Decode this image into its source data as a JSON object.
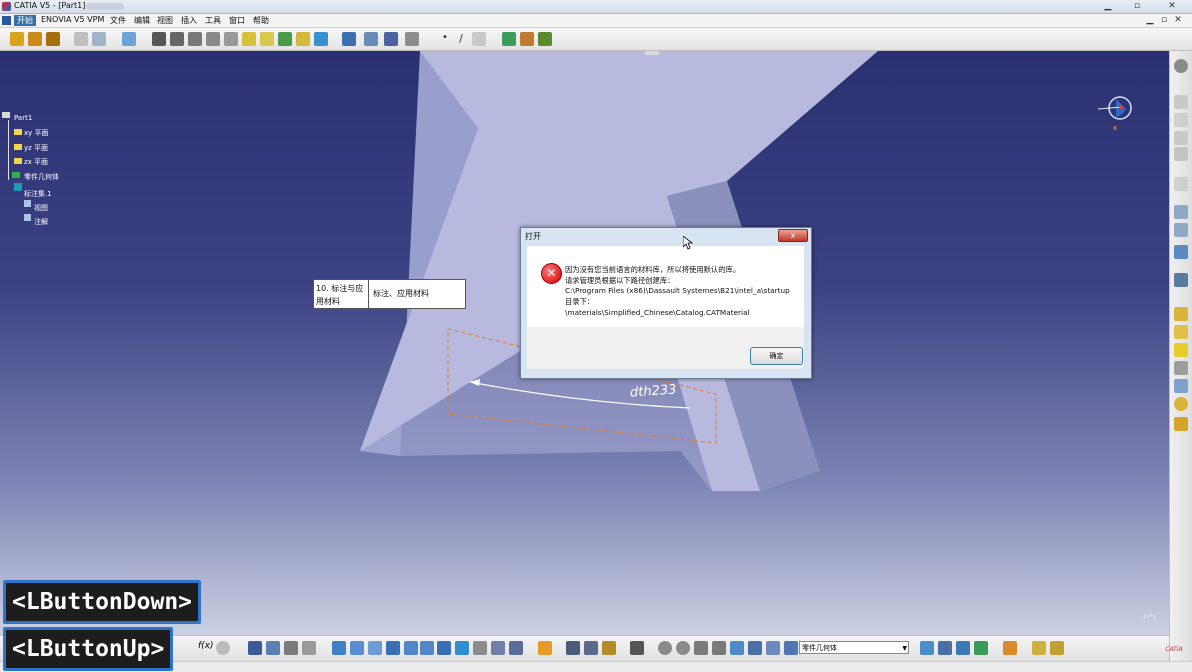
{
  "window": {
    "title": "CATIA V5 - [Part1]",
    "min_icon": "minimize-icon",
    "max_icon": "restore-icon",
    "close_icon": "close-icon"
  },
  "menu": {
    "items": [
      "开始",
      "ENOVIA V5 VPM",
      "文件",
      "编辑",
      "视图",
      "插入",
      "工具",
      "窗口",
      "帮助"
    ]
  },
  "tree": {
    "root": "Part1",
    "items": [
      "xy 平面",
      "yz 平面",
      "zx 平面",
      "零件几何体",
      "标注集.1",
      "视图",
      "注解"
    ]
  },
  "tooltip": {
    "col1": "10. 标注与应用材料",
    "col2": "标注、应用材料"
  },
  "dimension_label": "dth233",
  "dialog": {
    "title": "打开",
    "close_label": "x",
    "lines": [
      "因为没有您当前语言的材料库，所以将使用默认的库。",
      "请求管理员根据以下路径创建库：",
      "C:\\Program Files (x86)\\Dassault Systemes\\B21\\intel_a\\startup",
      "目录下：",
      "\\materials\\Simplified_Chinese\\Catalog.CATMaterial"
    ],
    "ok_label": "确定"
  },
  "bottom": {
    "combo_value": "零件几何体"
  },
  "overlays": {
    "down": "<LButtonDown>",
    "up": "<LButtonUp>"
  },
  "colors": {
    "viewport_top": "#2b3071",
    "part_face": "#b4b6dc",
    "part_side": "#8f93c0",
    "dialog_accent": "#3c7fb1",
    "overlay_border": "#2f74c9"
  }
}
